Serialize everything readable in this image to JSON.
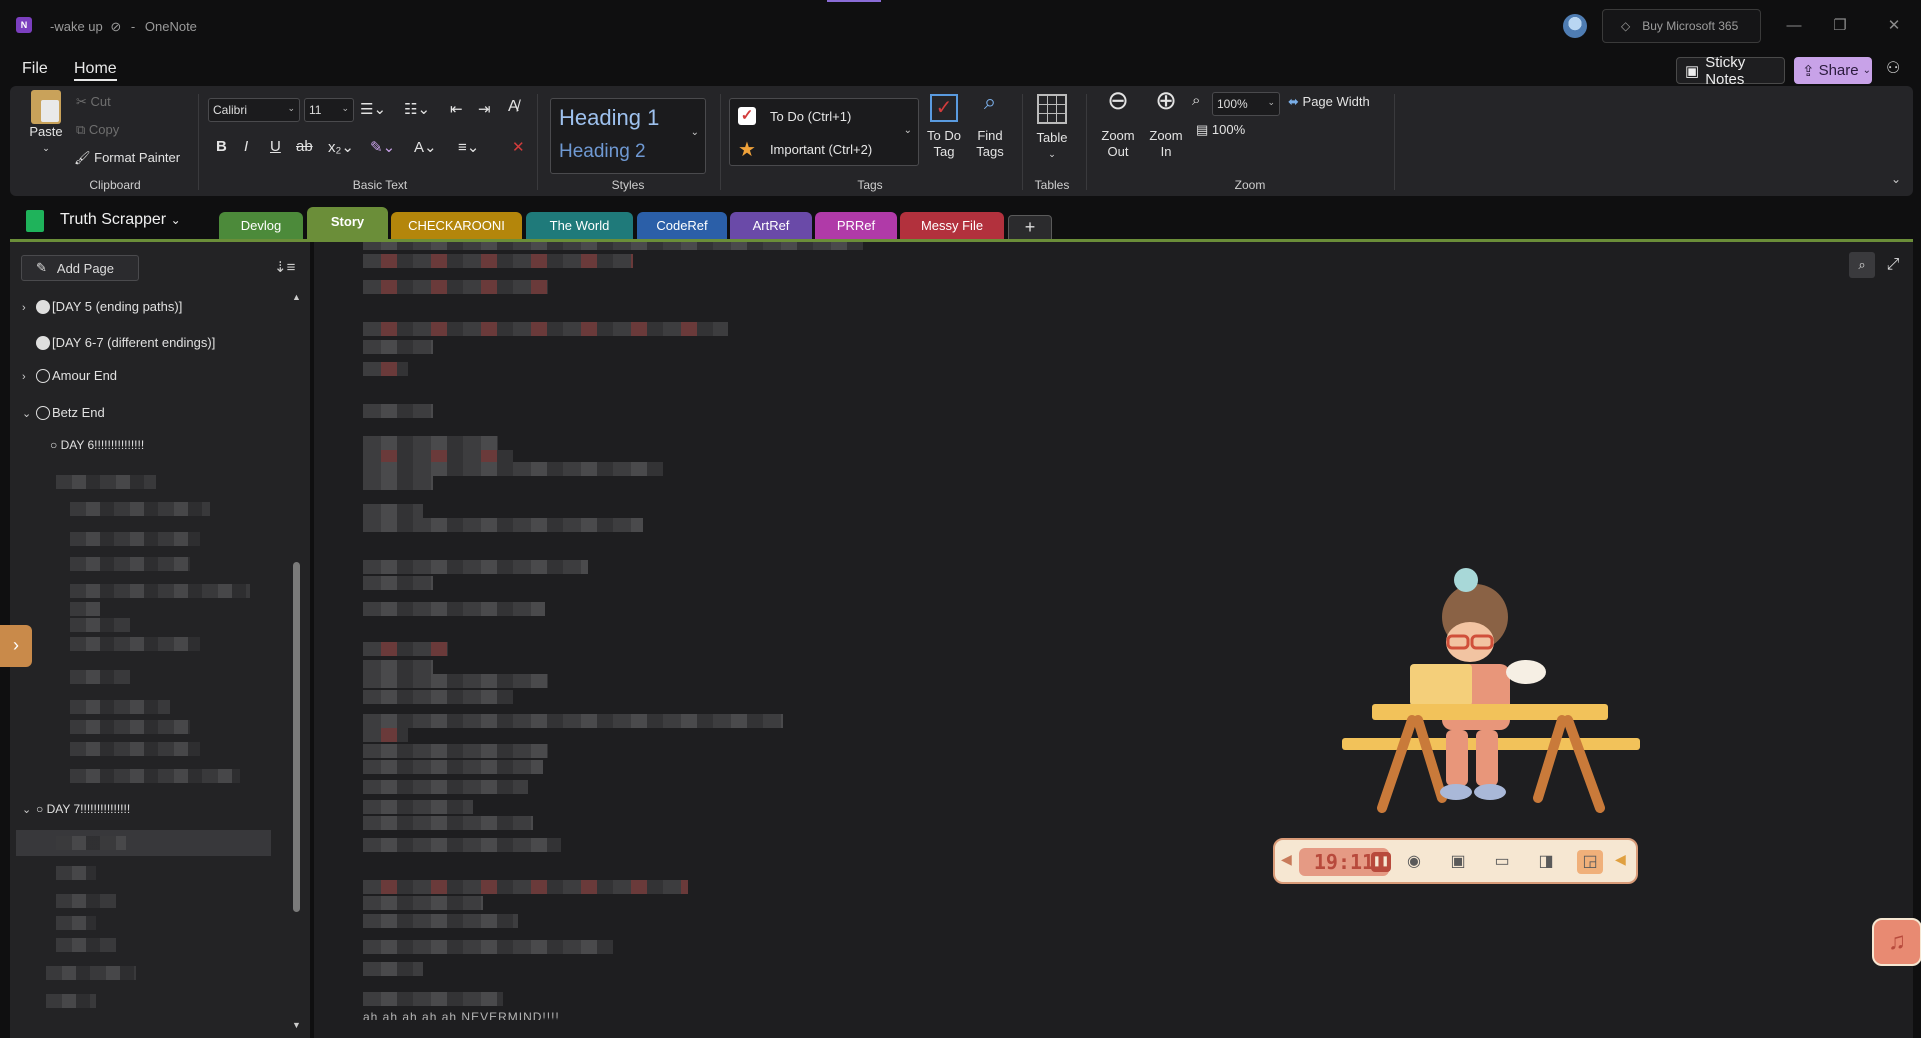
{
  "window": {
    "page_title": "-wake up",
    "app_name": "OneNote",
    "separator": "-",
    "buy_label": "Buy Microsoft 365"
  },
  "menu": {
    "file": "File",
    "home": "Home",
    "sticky_notes": "Sticky Notes",
    "share": "Share"
  },
  "ribbon": {
    "clipboard": {
      "paste": "Paste",
      "cut": "Cut",
      "copy": "Copy",
      "format_painter": "Format Painter",
      "label": "Clipboard"
    },
    "basic_text": {
      "font": "Calibri",
      "size": "11",
      "label": "Basic Text"
    },
    "styles": {
      "heading1": "Heading 1",
      "heading2": "Heading 2",
      "label": "Styles"
    },
    "tags": {
      "todo": "To Do (Ctrl+1)",
      "important": "Important (Ctrl+2)",
      "todo_tag_1": "To Do",
      "todo_tag_2": "Tag",
      "find_tags_1": "Find",
      "find_tags_2": "Tags",
      "label": "Tags"
    },
    "tables": {
      "table": "Table",
      "label": "Tables"
    },
    "zoom": {
      "zoom_out_1": "Zoom",
      "zoom_out_2": "Out",
      "zoom_in_1": "Zoom",
      "zoom_in_2": "In",
      "zoom_value": "100%",
      "page_width": "Page Width",
      "hundred": "100%",
      "label": "Zoom"
    }
  },
  "notebook": {
    "name": "Truth Scrapper",
    "sections": [
      {
        "label": "Devlog",
        "color": "#4c8a3a"
      },
      {
        "label": "Story",
        "color": "#6b8e39",
        "active": true
      },
      {
        "label": "CHECKAROONI",
        "color": "#b4860b"
      },
      {
        "label": "The World",
        "color": "#1f7a7a"
      },
      {
        "label": "CodeRef",
        "color": "#2b5fa8"
      },
      {
        "label": "ArtRef",
        "color": "#6a4aa8"
      },
      {
        "label": "PRRef",
        "color": "#b03aa8"
      },
      {
        "label": "Messy File",
        "color": "#b2313d"
      }
    ],
    "add_tab": "+"
  },
  "pages_panel": {
    "add_page": "Add Page",
    "items": [
      {
        "label": "[DAY 5 (ending paths)]",
        "chevron": "›",
        "dot": "filled"
      },
      {
        "label": "[DAY 6-7 (different endings)]",
        "chevron": "",
        "dot": "filled"
      },
      {
        "label": "Amour End",
        "chevron": "›",
        "dot": "hollow"
      },
      {
        "label": "Betz End",
        "chevron": "⌄",
        "dot": "hollow"
      },
      {
        "label": "○ DAY 6!!!!!!!!!!!!!!!",
        "chevron": "",
        "dot": "none"
      },
      {
        "label": "○ DAY 7!!!!!!!!!!!!!!!",
        "chevron": "⌄",
        "dot": "none"
      }
    ]
  },
  "note": {
    "last_line": "ah ah ah ah ah NEVERMIND!!!!"
  },
  "widget": {
    "timer": "19:11"
  },
  "icons": {
    "music": "music-note-icon",
    "search": "search-icon"
  }
}
